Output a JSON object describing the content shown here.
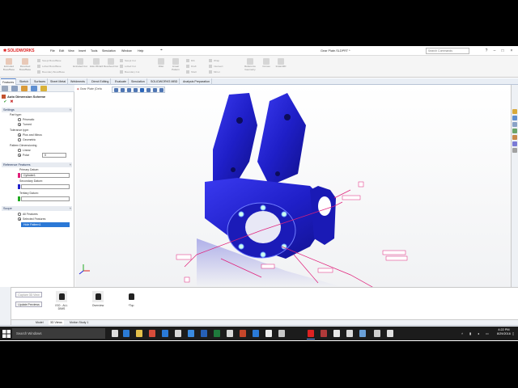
{
  "window": {
    "logo_text": "SOLIDWORKS",
    "doc_title": "Gear Plate.SLDPRT *",
    "search_placeholder": "Search Commands",
    "menus": [
      "File",
      "Edit",
      "View",
      "Insert",
      "Tools",
      "Simulation",
      "Window",
      "Help"
    ]
  },
  "command_manager": {
    "large_buttons": [
      "Extruded Boss/Base",
      "Revolved Boss/Base",
      "Extruded Cut",
      "Hole Wizard",
      "Revolved Cut",
      "Fillet",
      "Linear Pattern",
      "Rib",
      "Wrap",
      "Reference Geometry",
      "Curves",
      "Instant3D"
    ],
    "small_rows": [
      "Swept Boss/Base",
      "Lofted Boss/Base",
      "Boundary Boss/Base",
      "Swept Cut",
      "Lofted Cut",
      "Boundary Cut",
      "Draft",
      "Shell",
      "Mirror",
      "Intersect"
    ],
    "tabs": [
      "Features",
      "Sketch",
      "Surfaces",
      "Sheet Metal",
      "Weldments",
      "Direct Editing",
      "Evaluate",
      "Simulation",
      "SOLIDWORKS MBD",
      "Analysis Preparation"
    ],
    "active_tab": "Features"
  },
  "property_manager": {
    "title": "Auto Dimension Scheme",
    "crumb": "Gear Plate (Defa",
    "settings_label": "Settings",
    "part_type_label": "Part type:",
    "part_types": [
      "Prismatic",
      "Turned"
    ],
    "part_type_selected": "Turned",
    "tolerance_label": "Tolerance type:",
    "tolerance_types": [
      "Plus and Minus",
      "Geometric"
    ],
    "tolerance_selected": "Plus and Minus",
    "pattern_label": "Pattern Dimensioning",
    "pattern_types": [
      "Linear",
      "Polar"
    ],
    "pattern_selected": "Polar",
    "polar_value": "0",
    "ref_features_label": "Reference Features",
    "primary_datum_label": "Primary Datum:",
    "primary_datum_value": "Cylinder1",
    "secondary_datum_label": "Secondary Datum:",
    "tertiary_datum_label": "Tertiary Datum:",
    "scope_label": "Scope",
    "scope_types": [
      "All Features",
      "Selected Features"
    ],
    "scope_selected": "Selected Features",
    "scope_field_value": "Hole Pattern1"
  },
  "bottom_panel": {
    "capture_button": "Capture 3D View",
    "update_button": "Update Previews",
    "views": [
      {
        "label": "ISO - ALL DIMS"
      },
      {
        "label": "Overview"
      },
      {
        "label": "*Top"
      }
    ]
  },
  "model_tabs": [
    "Model",
    "3D Views",
    "Motion Study 1"
  ],
  "model_tab_active": "3D Views",
  "status": {
    "left": "Gear Plate",
    "editing": "Editing Part",
    "units": "MMGS"
  },
  "taskbar": {
    "search_placeholder": "Search Windows",
    "time": "4:22 PM",
    "date": "8/29/2016"
  },
  "colors": {
    "part_blue": "#1f1fc8",
    "annotation_magenta": "#e0207a",
    "solidworks_red": "#d22222",
    "selection_blue": "#2b78d6"
  }
}
